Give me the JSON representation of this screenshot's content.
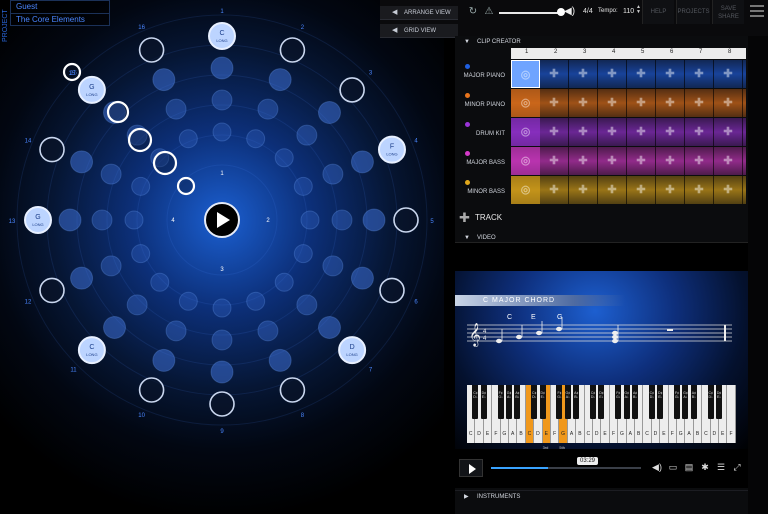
{
  "project": {
    "tag": "PROJECT",
    "user": "Guest",
    "name": "The Core Elements"
  },
  "circle": {
    "outer_numbers": [
      "1",
      "2",
      "3",
      "4",
      "5",
      "6",
      "7",
      "8",
      "9",
      "10",
      "11",
      "12",
      "13",
      "14",
      "15",
      "16"
    ],
    "inner_numbers": [
      "1",
      "2",
      "3",
      "4"
    ],
    "notes": [
      {
        "step": 1,
        "note": "C",
        "sub": "LONG"
      },
      {
        "step": 4,
        "note": "F",
        "sub": "LONG"
      },
      {
        "step": 7,
        "note": "D",
        "sub": "LONG"
      },
      {
        "step": 11,
        "note": "C",
        "sub": "LONG"
      },
      {
        "step": 13,
        "note": "G",
        "sub": "LONG"
      },
      {
        "step": 15,
        "note": "G",
        "sub": "LONG"
      }
    ],
    "selected_label": "15"
  },
  "topbar": {
    "arrange_view": "ARRANGE VIEW",
    "grid_view": "GRID VIEW",
    "time_signature": "4/4",
    "tempo_label": "Tempo:",
    "tempo_value": "110",
    "help": "HELP",
    "projects": "PROJECTS",
    "save_share": "SAVE SHARE",
    "volume_level": 0.95
  },
  "clip_creator": {
    "title": "CLIP CREATOR",
    "columns": [
      "1",
      "2",
      "3",
      "4",
      "5",
      "6",
      "7",
      "8"
    ],
    "tracks": [
      {
        "name": "MAJOR PIANO",
        "color": "#1f5fe0"
      },
      {
        "name": "MINOR PIANO",
        "color": "#e8741c"
      },
      {
        "name": "DRUM KIT",
        "color": "#9a34d8"
      },
      {
        "name": "MAJOR BASS",
        "color": "#d43ac8"
      },
      {
        "name": "MINOR BASS",
        "color": "#e0a81c"
      }
    ],
    "add_track": "TRACK"
  },
  "video": {
    "title": "VIDEO",
    "chord_title": "C MAJOR CHORD",
    "staff_notes": [
      "C",
      "E",
      "G"
    ],
    "white_keys": [
      "C",
      "D",
      "E",
      "F",
      "G",
      "A",
      "B",
      "C",
      "D",
      "E",
      "F",
      "G",
      "A",
      "B",
      "C",
      "D",
      "E",
      "F",
      "G",
      "A",
      "B",
      "C",
      "D",
      "E",
      "F",
      "G",
      "A",
      "B",
      "C",
      "D",
      "E",
      "F"
    ],
    "black_keys": [
      "C♯ D♭",
      "D♯ E♭",
      "F♯ G♭",
      "G♯ A♭",
      "A♯ B♭",
      "C♯ D♭",
      "D♯ E♭",
      "F♯ G♭",
      "G♯ A♭",
      "A♯ B♭",
      "C♯ D♭",
      "D♯ E♭",
      "F♯ G♭",
      "G♯ A♭",
      "A♯ B♭",
      "C♯ D♭",
      "D♯ E♭",
      "F♯ G♭",
      "G♯ A♭",
      "A♯ B♭",
      "C♯ D♭",
      "D♯ E♭"
    ],
    "highlighted_keys": [
      7,
      9,
      11
    ],
    "key_annotations": [
      "3rd",
      "5th"
    ],
    "timecode": "03:29",
    "progress": 0.38
  },
  "instruments": {
    "title": "INSTRUMENTS"
  }
}
